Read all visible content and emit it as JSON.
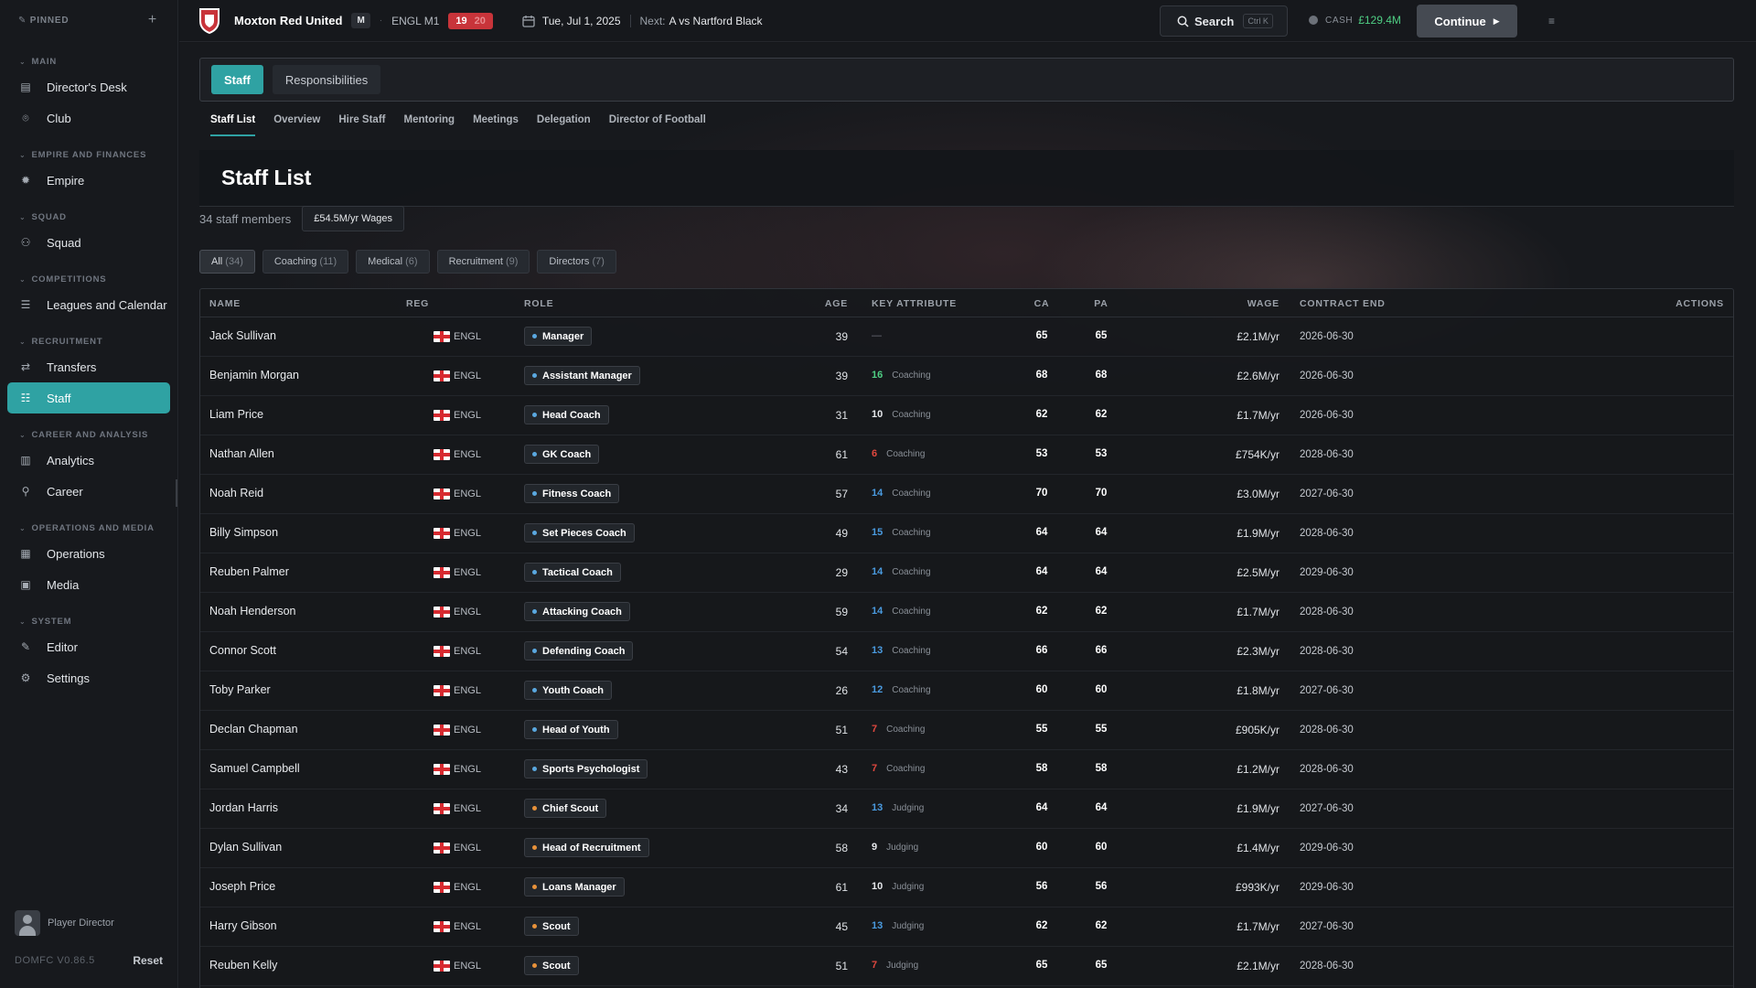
{
  "colors": {
    "accent": "#2fa2a3",
    "coaching_role_dot": "#5aa8e0",
    "judging_role_dot": "#e8923a",
    "key_green": "#4fcf84",
    "key_blue": "#4a9be0",
    "key_red": "#e0483f",
    "key_white": "#e6e8eb"
  },
  "sidebar": {
    "pinned_label": "PINNED",
    "sections": [
      {
        "label": "MAIN",
        "items": [
          {
            "label": "Director's Desk",
            "icon": "clipboard-icon"
          },
          {
            "label": "Club",
            "icon": "pin-icon"
          }
        ]
      },
      {
        "label": "EMPIRE AND FINANCES",
        "items": [
          {
            "label": "Empire",
            "icon": "gear-icon"
          }
        ]
      },
      {
        "label": "SQUAD",
        "items": [
          {
            "label": "Squad",
            "icon": "users-icon"
          }
        ]
      },
      {
        "label": "COMPETITIONS",
        "items": [
          {
            "label": "Leagues and Calendar",
            "icon": "list-icon"
          }
        ]
      },
      {
        "label": "RECRUITMENT",
        "items": [
          {
            "label": "Transfers",
            "icon": "swap-icon"
          },
          {
            "label": "Staff",
            "icon": "staff-icon",
            "active": true
          }
        ]
      },
      {
        "label": "CAREER AND ANALYSIS",
        "items": [
          {
            "label": "Analytics",
            "icon": "bar-chart-icon"
          },
          {
            "label": "Career",
            "icon": "person-icon"
          }
        ]
      },
      {
        "label": "OPERATIONS AND MEDIA",
        "items": [
          {
            "label": "Operations",
            "icon": "building-icon"
          },
          {
            "label": "Media",
            "icon": "newspaper-icon"
          }
        ]
      },
      {
        "label": "SYSTEM",
        "items": [
          {
            "label": "Editor",
            "icon": "pencil-icon"
          },
          {
            "label": "Settings",
            "icon": "settings-icon"
          }
        ]
      }
    ],
    "user_label": "Player Director",
    "version": "DOMFC V0.86.5",
    "reset_label": "Reset"
  },
  "topbar": {
    "club_name": "Moxton Red United",
    "badge": "M",
    "league": "ENGL M1",
    "position": "19",
    "position_sub": "20",
    "date": "Tue, Jul 1, 2025",
    "next_label": "Next:",
    "next_value": "A  vs Nartford Black",
    "search_label": "Search",
    "search_shortcut": "Ctrl K",
    "cash_label": "CASH",
    "cash_value": "£129.4M",
    "continue_label": "Continue"
  },
  "tabs": [
    {
      "label": "Staff",
      "active": true
    },
    {
      "label": "Responsibilities",
      "active": false
    }
  ],
  "subtabs": [
    {
      "label": "Staff List",
      "active": true
    },
    {
      "label": "Overview"
    },
    {
      "label": "Hire Staff"
    },
    {
      "label": "Mentoring"
    },
    {
      "label": "Meetings"
    },
    {
      "label": "Delegation"
    },
    {
      "label": "Director of Football"
    }
  ],
  "page": {
    "title": "Staff List",
    "count": "34 staff members",
    "wages": "£54.5M/yr Wages"
  },
  "filters": [
    {
      "label": "All",
      "count": "(34)",
      "active": true
    },
    {
      "label": "Coaching",
      "count": "(11)"
    },
    {
      "label": "Medical",
      "count": "(6)"
    },
    {
      "label": "Recruitment",
      "count": "(9)"
    },
    {
      "label": "Directors",
      "count": "(7)"
    }
  ],
  "table": {
    "headers": {
      "name": "NAME",
      "reg": "REG",
      "role": "ROLE",
      "age": "AGE",
      "key": "KEY ATTRIBUTE",
      "ca": "CA",
      "pa": "PA",
      "wage": "WAGE",
      "contract": "CONTRACT END",
      "actions": "ACTIONS"
    },
    "rows": [
      {
        "name": "Jack Sullivan",
        "reg": "ENGL",
        "role": "Manager",
        "role_type": "coaching",
        "age": "39",
        "key_value": "—",
        "key_label": "",
        "key_color": "none",
        "ca": "65",
        "pa": "65",
        "wage": "£2.1M/yr",
        "contract": "2026-06-30"
      },
      {
        "name": "Benjamin Morgan",
        "reg": "ENGL",
        "role": "Assistant Manager",
        "role_type": "coaching",
        "age": "39",
        "key_value": "16",
        "key_label": "Coaching",
        "key_color": "green",
        "ca": "68",
        "pa": "68",
        "wage": "£2.6M/yr",
        "contract": "2026-06-30"
      },
      {
        "name": "Liam Price",
        "reg": "ENGL",
        "role": "Head Coach",
        "role_type": "coaching",
        "age": "31",
        "key_value": "10",
        "key_label": "Coaching",
        "key_color": "white",
        "ca": "62",
        "pa": "62",
        "wage": "£1.7M/yr",
        "contract": "2026-06-30"
      },
      {
        "name": "Nathan Allen",
        "reg": "ENGL",
        "role": "GK Coach",
        "role_type": "coaching",
        "age": "61",
        "key_value": "6",
        "key_label": "Coaching",
        "key_color": "red",
        "ca": "53",
        "pa": "53",
        "wage": "£754K/yr",
        "contract": "2028-06-30"
      },
      {
        "name": "Noah Reid",
        "reg": "ENGL",
        "role": "Fitness Coach",
        "role_type": "coaching",
        "age": "57",
        "key_value": "14",
        "key_label": "Coaching",
        "key_color": "blue",
        "ca": "70",
        "pa": "70",
        "wage": "£3.0M/yr",
        "contract": "2027-06-30"
      },
      {
        "name": "Billy Simpson",
        "reg": "ENGL",
        "role": "Set Pieces Coach",
        "role_type": "coaching",
        "age": "49",
        "key_value": "15",
        "key_label": "Coaching",
        "key_color": "blue",
        "ca": "64",
        "pa": "64",
        "wage": "£1.9M/yr",
        "contract": "2028-06-30"
      },
      {
        "name": "Reuben Palmer",
        "reg": "ENGL",
        "role": "Tactical Coach",
        "role_type": "coaching",
        "age": "29",
        "key_value": "14",
        "key_label": "Coaching",
        "key_color": "blue",
        "ca": "64",
        "pa": "64",
        "wage": "£2.5M/yr",
        "contract": "2029-06-30"
      },
      {
        "name": "Noah Henderson",
        "reg": "ENGL",
        "role": "Attacking Coach",
        "role_type": "coaching",
        "age": "59",
        "key_value": "14",
        "key_label": "Coaching",
        "key_color": "blue",
        "ca": "62",
        "pa": "62",
        "wage": "£1.7M/yr",
        "contract": "2028-06-30"
      },
      {
        "name": "Connor Scott",
        "reg": "ENGL",
        "role": "Defending Coach",
        "role_type": "coaching",
        "age": "54",
        "key_value": "13",
        "key_label": "Coaching",
        "key_color": "blue",
        "ca": "66",
        "pa": "66",
        "wage": "£2.3M/yr",
        "contract": "2028-06-30"
      },
      {
        "name": "Toby Parker",
        "reg": "ENGL",
        "role": "Youth Coach",
        "role_type": "coaching",
        "age": "26",
        "key_value": "12",
        "key_label": "Coaching",
        "key_color": "blue",
        "ca": "60",
        "pa": "60",
        "wage": "£1.8M/yr",
        "contract": "2027-06-30"
      },
      {
        "name": "Declan Chapman",
        "reg": "ENGL",
        "role": "Head of Youth",
        "role_type": "coaching",
        "age": "51",
        "key_value": "7",
        "key_label": "Coaching",
        "key_color": "red",
        "ca": "55",
        "pa": "55",
        "wage": "£905K/yr",
        "contract": "2028-06-30"
      },
      {
        "name": "Samuel Campbell",
        "reg": "ENGL",
        "role": "Sports Psychologist",
        "role_type": "coaching",
        "age": "43",
        "key_value": "7",
        "key_label": "Coaching",
        "key_color": "red",
        "ca": "58",
        "pa": "58",
        "wage": "£1.2M/yr",
        "contract": "2028-06-30"
      },
      {
        "name": "Jordan Harris",
        "reg": "ENGL",
        "role": "Chief Scout",
        "role_type": "judging",
        "age": "34",
        "key_value": "13",
        "key_label": "Judging",
        "key_color": "blue",
        "ca": "64",
        "pa": "64",
        "wage": "£1.9M/yr",
        "contract": "2027-06-30"
      },
      {
        "name": "Dylan Sullivan",
        "reg": "ENGL",
        "role": "Head of Recruitment",
        "role_type": "judging",
        "age": "58",
        "key_value": "9",
        "key_label": "Judging",
        "key_color": "white",
        "ca": "60",
        "pa": "60",
        "wage": "£1.4M/yr",
        "contract": "2029-06-30"
      },
      {
        "name": "Joseph Price",
        "reg": "ENGL",
        "role": "Loans Manager",
        "role_type": "judging",
        "age": "61",
        "key_value": "10",
        "key_label": "Judging",
        "key_color": "white",
        "ca": "56",
        "pa": "56",
        "wage": "£993K/yr",
        "contract": "2029-06-30"
      },
      {
        "name": "Harry Gibson",
        "reg": "ENGL",
        "role": "Scout",
        "role_type": "judging",
        "age": "45",
        "key_value": "13",
        "key_label": "Judging",
        "key_color": "blue",
        "ca": "62",
        "pa": "62",
        "wage": "£1.7M/yr",
        "contract": "2027-06-30"
      },
      {
        "name": "Reuben Kelly",
        "reg": "ENGL",
        "role": "Scout",
        "role_type": "judging",
        "age": "51",
        "key_value": "7",
        "key_label": "Judging",
        "key_color": "red",
        "ca": "65",
        "pa": "65",
        "wage": "£2.1M/yr",
        "contract": "2028-06-30"
      }
    ]
  }
}
